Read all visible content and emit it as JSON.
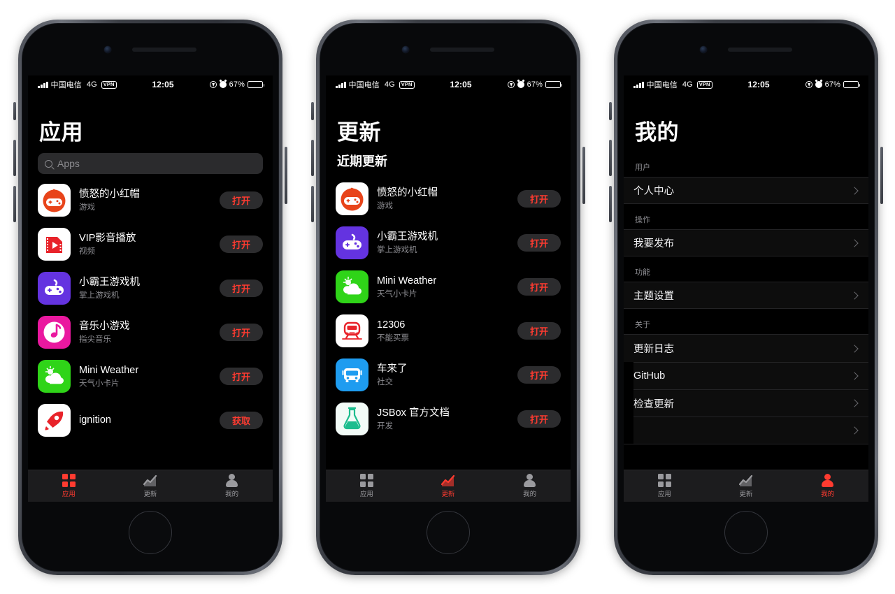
{
  "status_bar": {
    "carrier": "中国电信",
    "network": "4G",
    "vpn_badge": "VPN",
    "time": "12:05",
    "battery_percent": "67%"
  },
  "theme": {
    "accent": "#ff3b30",
    "background": "#000000",
    "tabbar_bg": "#1c1c1e",
    "secondary_text": "#8d8d92"
  },
  "tabbar": {
    "tabs": [
      {
        "label": "应用",
        "icon": "grid-icon"
      },
      {
        "label": "更新",
        "icon": "chart-icon"
      },
      {
        "label": "我的",
        "icon": "person-icon"
      }
    ]
  },
  "screens": [
    {
      "id": "apps",
      "title": "应用",
      "active_tab": 0,
      "search": {
        "placeholder": "Apps",
        "value": "",
        "icon": "search-icon"
      },
      "apps": [
        {
          "name": "愤怒的小红帽",
          "desc": "游戏",
          "action": "打开",
          "icon": "gamepad-orange-icon",
          "icon_bg": "#ffffff",
          "icon_fg": "#e8441a"
        },
        {
          "name": "VIP影音播放",
          "desc": "视频",
          "action": "打开",
          "icon": "video-red-icon",
          "icon_bg": "#ffffff",
          "icon_fg": "#e8232a"
        },
        {
          "name": "小霸王游戏机",
          "desc": "掌上游戏机",
          "action": "打开",
          "icon": "gamepad-purple-icon",
          "icon_bg": "#6433e0",
          "icon_fg": "#ffffff"
        },
        {
          "name": "音乐小游戏",
          "desc": "指尖音乐",
          "action": "打开",
          "icon": "music-note-icon",
          "icon_bg": "#ea189f",
          "icon_fg": "#ffffff"
        },
        {
          "name": "Mini Weather",
          "desc": "天气小卡片",
          "action": "打开",
          "icon": "weather-cloud-icon",
          "icon_bg": "#2fd418",
          "icon_fg": "#ffffff"
        },
        {
          "name": "ignition",
          "desc": "",
          "action": "获取",
          "icon": "rocket-icon",
          "icon_bg": "#ffffff",
          "icon_fg": "#e8232a"
        }
      ]
    },
    {
      "id": "updates",
      "title": "更新",
      "subtitle": "近期更新",
      "active_tab": 1,
      "apps": [
        {
          "name": "愤怒的小红帽",
          "desc": "游戏",
          "action": "打开",
          "icon": "gamepad-orange-icon",
          "icon_bg": "#ffffff",
          "icon_fg": "#e8441a"
        },
        {
          "name": "小霸王游戏机",
          "desc": "掌上游戏机",
          "action": "打开",
          "icon": "gamepad-purple-icon",
          "icon_bg": "#6433e0",
          "icon_fg": "#ffffff"
        },
        {
          "name": "Mini Weather",
          "desc": "天气小卡片",
          "action": "打开",
          "icon": "weather-cloud-icon",
          "icon_bg": "#2fd418",
          "icon_fg": "#ffffff"
        },
        {
          "name": "12306",
          "desc": "不能买票",
          "action": "打开",
          "icon": "train-icon",
          "icon_bg": "#ffffff",
          "icon_fg": "#e8232a"
        },
        {
          "name": "车来了",
          "desc": "社交",
          "action": "打开",
          "icon": "bus-icon",
          "icon_bg": "#1e9cf0",
          "icon_fg": "#ffffff"
        },
        {
          "name": "JSBox 官方文档",
          "desc": "开发",
          "action": "打开",
          "icon": "flask-icon",
          "icon_bg": "#f2fbf7",
          "icon_fg": "#1dbd8e"
        }
      ]
    },
    {
      "id": "mine",
      "title": "我的",
      "active_tab": 2,
      "sections": [
        {
          "header": "用户",
          "items": [
            {
              "label": "个人中心"
            }
          ]
        },
        {
          "header": "操作",
          "items": [
            {
              "label": "我要发布"
            }
          ]
        },
        {
          "header": "功能",
          "items": [
            {
              "label": "主题设置"
            }
          ]
        },
        {
          "header": "关于",
          "items": [
            {
              "label": "更新日志"
            },
            {
              "label": "GitHub"
            },
            {
              "label": "检查更新"
            }
          ]
        }
      ]
    }
  ]
}
